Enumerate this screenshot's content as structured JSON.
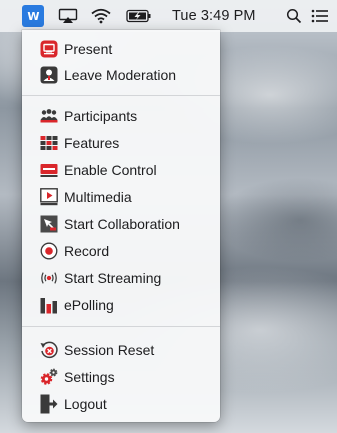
{
  "menubar": {
    "app_icon": "vidyo-app-icon",
    "app_icon_text": "W",
    "icons": [
      "airplay-icon",
      "wifi-icon",
      "battery-charging-icon",
      "search-icon",
      "notification-center-icon"
    ],
    "clock": "Tue 3:49 PM"
  },
  "menu": {
    "groups": [
      [
        {
          "label": "Present",
          "icon": "present-icon"
        },
        {
          "label": "Leave Moderation",
          "icon": "moderator-icon"
        }
      ],
      [
        {
          "label": "Participants",
          "icon": "participants-icon"
        },
        {
          "label": "Features",
          "icon": "features-icon"
        },
        {
          "label": "Enable Control",
          "icon": "enable-control-icon"
        },
        {
          "label": "Multimedia",
          "icon": "multimedia-icon"
        },
        {
          "label": "Start Collaboration",
          "icon": "collaboration-icon"
        },
        {
          "label": "Record",
          "icon": "record-icon"
        },
        {
          "label": "Start Streaming",
          "icon": "streaming-icon"
        },
        {
          "label": "ePolling",
          "icon": "epolling-icon"
        }
      ],
      [
        {
          "label": "Session Reset",
          "icon": "session-reset-icon"
        },
        {
          "label": "Settings",
          "icon": "settings-icon"
        },
        {
          "label": "Logout",
          "icon": "logout-icon"
        }
      ]
    ]
  },
  "colors": {
    "accent_red": "#d9262b",
    "app_blue": "#2a7be0",
    "icon_dark": "#3a3a3a"
  }
}
